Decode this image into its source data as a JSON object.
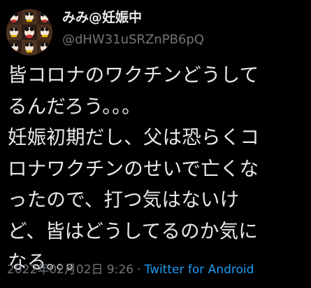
{
  "author": {
    "display_name": "みみ@妊娠中",
    "handle": "@dHW31uSRZnPB6pQ"
  },
  "tweet": {
    "lines": [
      "皆コロナのワクチンどうして",
      "るんだろう。。。",
      "妊娠初期だし、父は恐らくコ",
      "ロナワクチンのせいで亡くな",
      "ったので、打つ気はないけ",
      "ど、皆はどうしてるのか気に",
      "なる。。。"
    ],
    "timestamp": "2022年02月02日 9:26",
    "separator": "·",
    "source": "Twitter for Android"
  },
  "colors": {
    "background": "#000000",
    "text": "#e7e9ea",
    "secondary": "#71767b",
    "link": "#1d9bf0"
  },
  "icons": {
    "avatar": "profile-avatar-image"
  }
}
